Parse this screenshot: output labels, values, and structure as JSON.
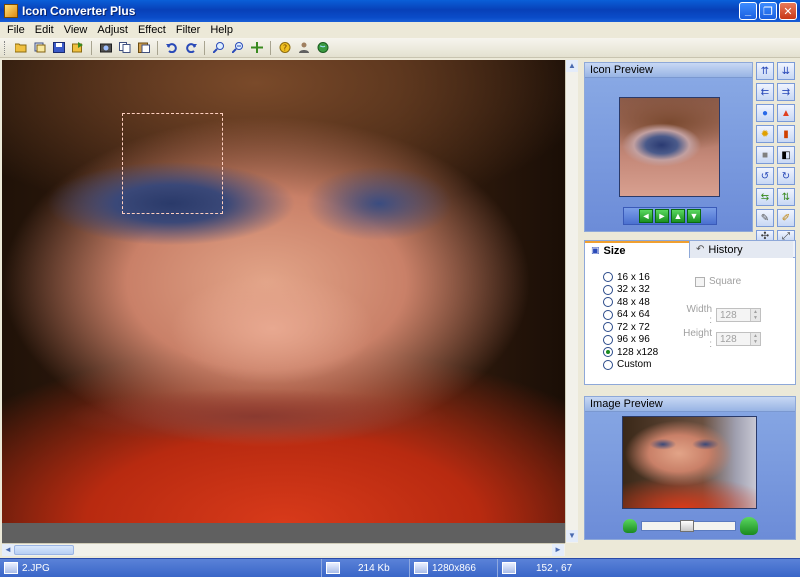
{
  "window": {
    "title": "Icon Converter Plus"
  },
  "menu": [
    "File",
    "Edit",
    "View",
    "Adjust",
    "Effect",
    "Filter",
    "Help"
  ],
  "toolbar": {
    "buttons": [
      {
        "name": "open-icon"
      },
      {
        "name": "browse-icon"
      },
      {
        "name": "save-icon"
      },
      {
        "name": "export-icon"
      },
      {
        "name": "capture-icon"
      },
      {
        "name": "copy-icon"
      },
      {
        "name": "paste-icon"
      },
      {
        "name": "undo-icon"
      },
      {
        "name": "redo-icon"
      },
      {
        "name": "zoom-in-icon"
      },
      {
        "name": "zoom-out-icon"
      },
      {
        "name": "fit-icon"
      },
      {
        "name": "help-icon"
      },
      {
        "name": "about-icon"
      },
      {
        "name": "web-icon"
      }
    ]
  },
  "icon_preview": {
    "title": "Icon Preview",
    "nav": [
      "◄",
      "►",
      "▲",
      "▼"
    ]
  },
  "size_tab": {
    "tab_size": "Size",
    "tab_history": "History",
    "options": [
      "16 x 16",
      "32 x 32",
      "48 x 48",
      "64 x 64",
      "72 x 72",
      "96 x 96",
      "128 x128",
      "Custom"
    ],
    "selected_index": 6,
    "square_label": "Square",
    "width_label": "Width :",
    "width_value": "128",
    "height_label": "Height :",
    "height_value": "128"
  },
  "image_preview": {
    "title": "Image Preview"
  },
  "status": {
    "filename": "2.JPG",
    "size": "214 Kb",
    "dimensions": "1280x866",
    "cursor": "152 , 67"
  },
  "colors": {
    "accent": "#0a4cc8",
    "panel": "#88a8e4",
    "status": "#3a66c8"
  }
}
